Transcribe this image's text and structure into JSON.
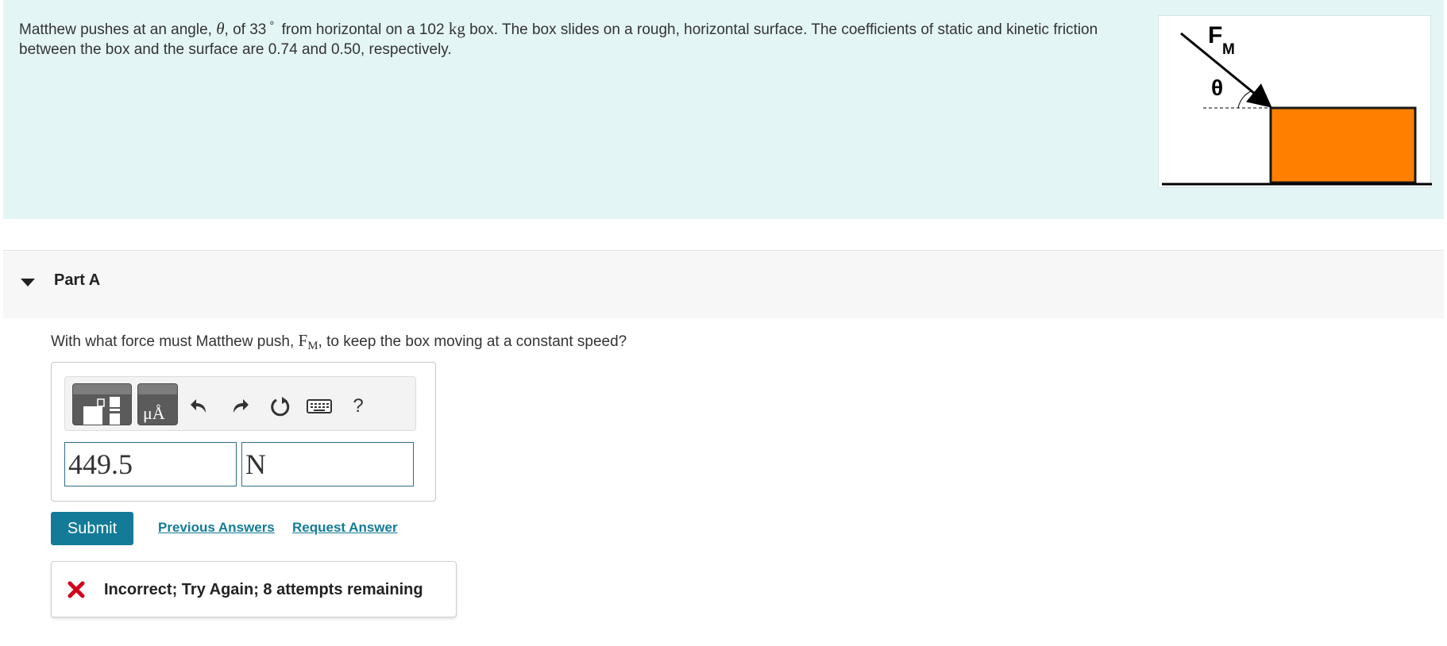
{
  "problem": {
    "text_1": "Matthew pushes at an angle, ",
    "theta": "θ",
    "text_2": ", of 33",
    "degree": "°",
    "text_3": " from horizontal on a 102 ",
    "unit_kg": "kg",
    "text_4": " box. The box slides on a rough, horizontal surface. The coefficients of static and kinetic friction between the box and the surface are 0.74 and 0.50, respectively.",
    "figure": {
      "force_label": "F",
      "force_subscript": "M",
      "angle_label": "θ",
      "box_color": "#ff8000"
    }
  },
  "part": {
    "title": "Part A",
    "question_1": "With what force must Matthew push, ",
    "question_F": "F",
    "question_sub": "M",
    "question_2": ", to keep the box moving at a constant speed?"
  },
  "toolbar": {
    "template_icon": "templates-icon",
    "units_icon": "units-icon",
    "units_glyph": "μÅ",
    "undo_icon": "undo-icon",
    "redo_icon": "redo-icon",
    "reset_icon": "reset-icon",
    "keyboard_icon": "keyboard-icon",
    "help_label": "?"
  },
  "answer": {
    "value": "449.5",
    "unit": "N"
  },
  "actions": {
    "submit_label": "Submit",
    "previous_answers_label": "Previous Answers",
    "request_answer_label": "Request Answer"
  },
  "feedback": {
    "icon": "x-mark-icon",
    "icon_color": "#d0021b",
    "message": "Incorrect; Try Again; 8 attempts remaining"
  },
  "colors": {
    "problem_background": "#e4f5f5",
    "accent": "#137b97"
  }
}
